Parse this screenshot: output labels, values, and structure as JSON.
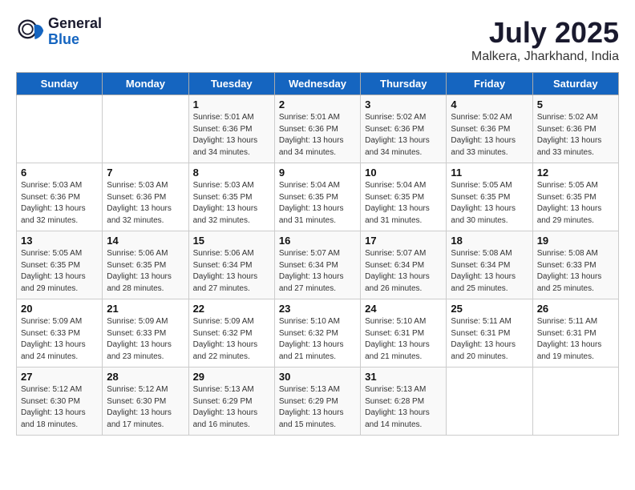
{
  "logo": {
    "general": "General",
    "blue": "Blue"
  },
  "title": "July 2025",
  "location": "Malkera, Jharkhand, India",
  "days_of_week": [
    "Sunday",
    "Monday",
    "Tuesday",
    "Wednesday",
    "Thursday",
    "Friday",
    "Saturday"
  ],
  "weeks": [
    [
      {
        "day": "",
        "info": ""
      },
      {
        "day": "",
        "info": ""
      },
      {
        "day": "1",
        "info": "Sunrise: 5:01 AM\nSunset: 6:36 PM\nDaylight: 13 hours and 34 minutes."
      },
      {
        "day": "2",
        "info": "Sunrise: 5:01 AM\nSunset: 6:36 PM\nDaylight: 13 hours and 34 minutes."
      },
      {
        "day": "3",
        "info": "Sunrise: 5:02 AM\nSunset: 6:36 PM\nDaylight: 13 hours and 34 minutes."
      },
      {
        "day": "4",
        "info": "Sunrise: 5:02 AM\nSunset: 6:36 PM\nDaylight: 13 hours and 33 minutes."
      },
      {
        "day": "5",
        "info": "Sunrise: 5:02 AM\nSunset: 6:36 PM\nDaylight: 13 hours and 33 minutes."
      }
    ],
    [
      {
        "day": "6",
        "info": "Sunrise: 5:03 AM\nSunset: 6:36 PM\nDaylight: 13 hours and 32 minutes."
      },
      {
        "day": "7",
        "info": "Sunrise: 5:03 AM\nSunset: 6:36 PM\nDaylight: 13 hours and 32 minutes."
      },
      {
        "day": "8",
        "info": "Sunrise: 5:03 AM\nSunset: 6:35 PM\nDaylight: 13 hours and 32 minutes."
      },
      {
        "day": "9",
        "info": "Sunrise: 5:04 AM\nSunset: 6:35 PM\nDaylight: 13 hours and 31 minutes."
      },
      {
        "day": "10",
        "info": "Sunrise: 5:04 AM\nSunset: 6:35 PM\nDaylight: 13 hours and 31 minutes."
      },
      {
        "day": "11",
        "info": "Sunrise: 5:05 AM\nSunset: 6:35 PM\nDaylight: 13 hours and 30 minutes."
      },
      {
        "day": "12",
        "info": "Sunrise: 5:05 AM\nSunset: 6:35 PM\nDaylight: 13 hours and 29 minutes."
      }
    ],
    [
      {
        "day": "13",
        "info": "Sunrise: 5:05 AM\nSunset: 6:35 PM\nDaylight: 13 hours and 29 minutes."
      },
      {
        "day": "14",
        "info": "Sunrise: 5:06 AM\nSunset: 6:35 PM\nDaylight: 13 hours and 28 minutes."
      },
      {
        "day": "15",
        "info": "Sunrise: 5:06 AM\nSunset: 6:34 PM\nDaylight: 13 hours and 27 minutes."
      },
      {
        "day": "16",
        "info": "Sunrise: 5:07 AM\nSunset: 6:34 PM\nDaylight: 13 hours and 27 minutes."
      },
      {
        "day": "17",
        "info": "Sunrise: 5:07 AM\nSunset: 6:34 PM\nDaylight: 13 hours and 26 minutes."
      },
      {
        "day": "18",
        "info": "Sunrise: 5:08 AM\nSunset: 6:34 PM\nDaylight: 13 hours and 25 minutes."
      },
      {
        "day": "19",
        "info": "Sunrise: 5:08 AM\nSunset: 6:33 PM\nDaylight: 13 hours and 25 minutes."
      }
    ],
    [
      {
        "day": "20",
        "info": "Sunrise: 5:09 AM\nSunset: 6:33 PM\nDaylight: 13 hours and 24 minutes."
      },
      {
        "day": "21",
        "info": "Sunrise: 5:09 AM\nSunset: 6:33 PM\nDaylight: 13 hours and 23 minutes."
      },
      {
        "day": "22",
        "info": "Sunrise: 5:09 AM\nSunset: 6:32 PM\nDaylight: 13 hours and 22 minutes."
      },
      {
        "day": "23",
        "info": "Sunrise: 5:10 AM\nSunset: 6:32 PM\nDaylight: 13 hours and 21 minutes."
      },
      {
        "day": "24",
        "info": "Sunrise: 5:10 AM\nSunset: 6:31 PM\nDaylight: 13 hours and 21 minutes."
      },
      {
        "day": "25",
        "info": "Sunrise: 5:11 AM\nSunset: 6:31 PM\nDaylight: 13 hours and 20 minutes."
      },
      {
        "day": "26",
        "info": "Sunrise: 5:11 AM\nSunset: 6:31 PM\nDaylight: 13 hours and 19 minutes."
      }
    ],
    [
      {
        "day": "27",
        "info": "Sunrise: 5:12 AM\nSunset: 6:30 PM\nDaylight: 13 hours and 18 minutes."
      },
      {
        "day": "28",
        "info": "Sunrise: 5:12 AM\nSunset: 6:30 PM\nDaylight: 13 hours and 17 minutes."
      },
      {
        "day": "29",
        "info": "Sunrise: 5:13 AM\nSunset: 6:29 PM\nDaylight: 13 hours and 16 minutes."
      },
      {
        "day": "30",
        "info": "Sunrise: 5:13 AM\nSunset: 6:29 PM\nDaylight: 13 hours and 15 minutes."
      },
      {
        "day": "31",
        "info": "Sunrise: 5:13 AM\nSunset: 6:28 PM\nDaylight: 13 hours and 14 minutes."
      },
      {
        "day": "",
        "info": ""
      },
      {
        "day": "",
        "info": ""
      }
    ]
  ]
}
